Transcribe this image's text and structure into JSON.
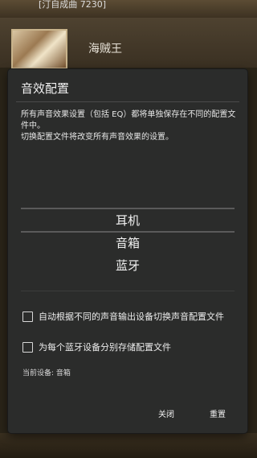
{
  "background": {
    "header_text": "[汀自成曲 7230]",
    "item_title": "海贼王"
  },
  "dialog": {
    "title": "音效配置",
    "description_line1": "所有声音效果设置（包括 EQ）都将单独保存在不同的配置文件中。",
    "description_line2": "切换配置文件将改变所有声音效果的设置。",
    "profiles": [
      {
        "label": "耳机"
      },
      {
        "label": "音箱"
      },
      {
        "label": "蓝牙"
      }
    ],
    "selected_profile": "音箱",
    "options": [
      {
        "label": "自动根据不同的声音输出设备切换声音配置文件",
        "checked": false
      },
      {
        "label": "为每个蓝牙设备分别存储配置文件",
        "checked": false
      }
    ],
    "current_device": "当前设备: 音箱",
    "buttons": {
      "close": "关闭",
      "reset": "重置"
    }
  }
}
